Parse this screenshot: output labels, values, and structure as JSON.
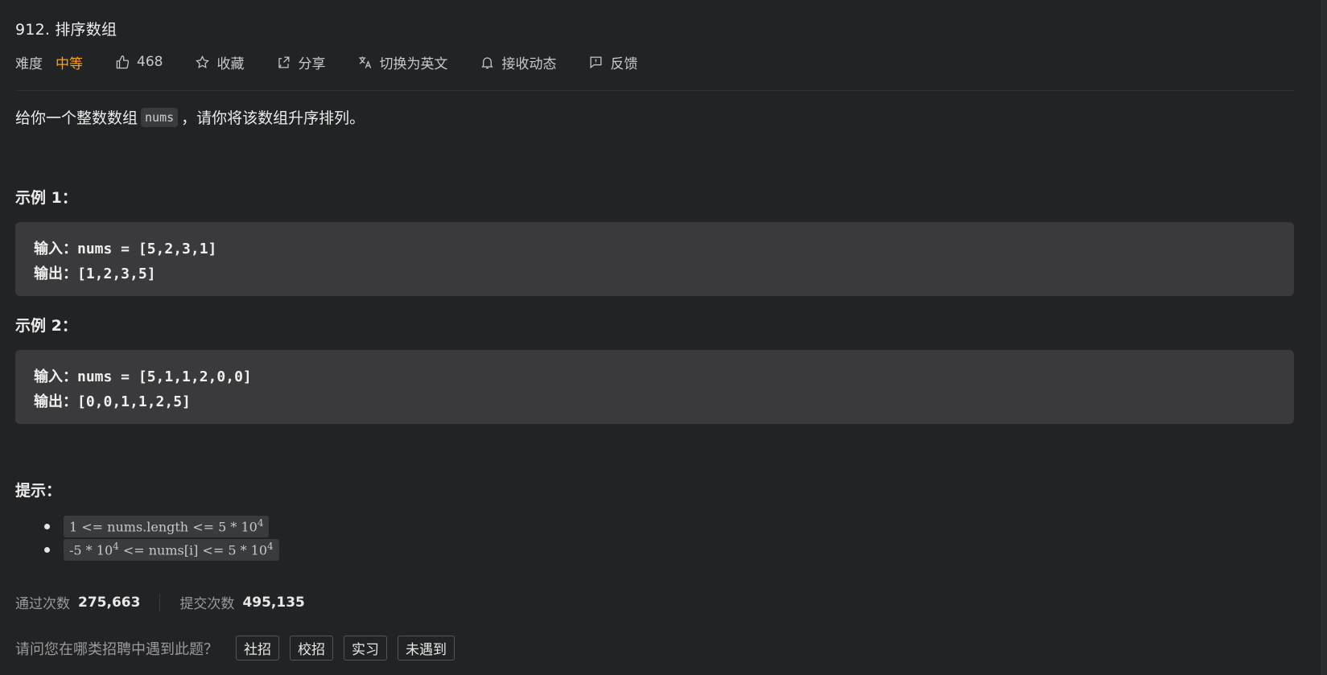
{
  "problem": {
    "title": "912. 排序数组",
    "difficulty_label": "难度",
    "difficulty_value": "中等",
    "likes": "468",
    "favorite_label": "收藏",
    "share_label": "分享",
    "switch_lang_label": "切换为英文",
    "subscribe_label": "接收动态",
    "feedback_label": "反馈"
  },
  "description": {
    "before": "给你一个整数数组",
    "code": "nums",
    "after": "，请你将该数组升序排列。"
  },
  "examples": [
    {
      "title": "示例 1：",
      "input": "输入：nums = [5,2,3,1]",
      "output": "输出：[1,2,3,5]"
    },
    {
      "title": "示例 2：",
      "input": "输入：nums = [5,1,1,2,0,0]",
      "output": "输出：[0,0,1,1,2,5]"
    }
  ],
  "hints": {
    "title": "提示：",
    "items": [
      {
        "prefix": "1 <= nums.length <= 5 * 10",
        "sup": "4",
        "suffix": ""
      },
      {
        "prefix": "-5 * 10",
        "sup": "4",
        "middle": " <= nums[i] <= 5 * 10",
        "sup2": "4"
      }
    ]
  },
  "stats": {
    "accepted_label": "通过次数",
    "accepted_value": "275,663",
    "submitted_label": "提交次数",
    "submitted_value": "495,135"
  },
  "survey": {
    "question": "请问您在哪类招聘中遇到此题？",
    "options": [
      "社招",
      "校招",
      "实习",
      "未遇到"
    ]
  },
  "colors": {
    "background": "#222325",
    "accent_difficulty": "#ffa116",
    "code_block_bg": "#3a3a3c"
  },
  "icons": {
    "like": "thumbs-up-icon",
    "favorite": "star-icon",
    "share": "share-icon",
    "translate": "translate-icon",
    "subscribe": "bell-icon",
    "feedback": "comment-icon"
  }
}
